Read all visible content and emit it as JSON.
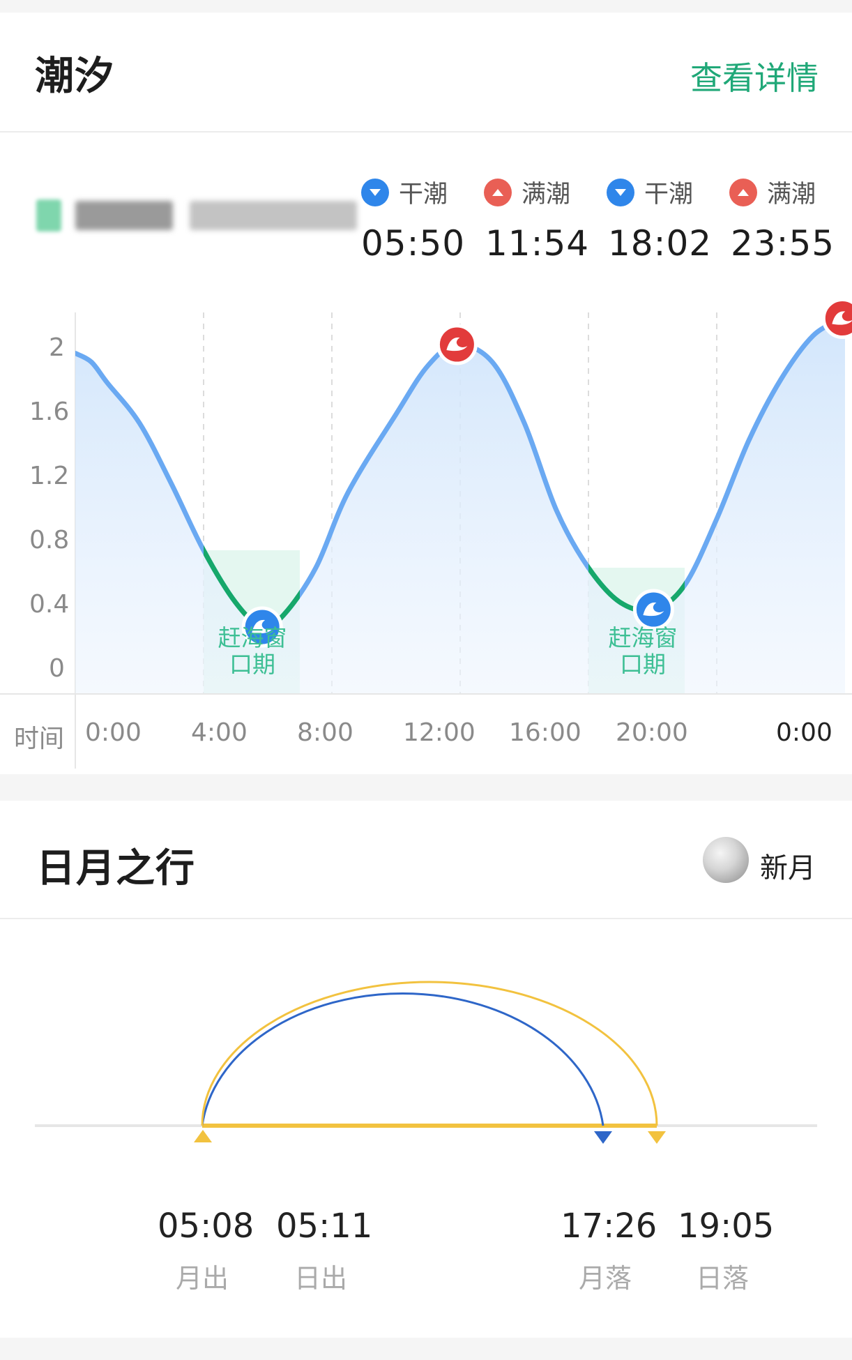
{
  "tide": {
    "title": "潮汐",
    "detail_link": "查看详情",
    "legend": [
      {
        "type": "low",
        "label": "干潮",
        "time": "05:50",
        "color": "#2f86ea"
      },
      {
        "type": "high",
        "label": "满潮",
        "time": "11:54",
        "color": "#e95f55"
      },
      {
        "type": "low",
        "label": "干潮",
        "time": "18:02",
        "color": "#2f86ea"
      },
      {
        "type": "high",
        "label": "满潮",
        "time": "23:55",
        "color": "#e95f55"
      }
    ],
    "window_label_line1": "赶海窗",
    "window_label_line2": "口期",
    "colors": {
      "curve": "#6aa9f2",
      "window_curve": "#16a86a",
      "fill": "#dbeafc",
      "window_text": "#3dbf94"
    }
  },
  "chart_data": {
    "type": "line",
    "x_unit": "hours",
    "xlim": [
      0,
      24
    ],
    "ylim": [
      0,
      2.1
    ],
    "yticks": [
      "2",
      "1.6",
      "1.2",
      "0.8",
      "0.4",
      "0"
    ],
    "ytick_values": [
      2,
      1.6,
      1.2,
      0.8,
      0.4,
      0
    ],
    "xlabel": "时间",
    "xticks": [
      "0:00",
      "4:00",
      "8:00",
      "12:00",
      "16:00",
      "20:00",
      "0:00"
    ],
    "xtick_values": [
      0,
      4,
      8,
      12,
      16,
      20,
      24
    ],
    "series": [
      {
        "x": [
          0,
          0.5,
          1,
          2,
          3,
          4,
          5,
          5.83,
          6.5,
          7.5,
          8.5,
          10,
          11,
          11.9,
          13,
          14,
          15,
          16,
          17,
          18.03,
          19,
          20,
          21,
          22,
          23,
          23.92,
          24
        ],
        "values": [
          1.95,
          1.9,
          1.78,
          1.55,
          1.2,
          0.82,
          0.52,
          0.38,
          0.45,
          0.72,
          1.15,
          1.6,
          1.88,
          2.0,
          1.9,
          1.55,
          1.05,
          0.72,
          0.52,
          0.48,
          0.62,
          1.0,
          1.45,
          1.8,
          2.05,
          2.15,
          2.18
        ]
      }
    ],
    "windows": [
      [
        4,
        7
      ],
      [
        16,
        19
      ]
    ],
    "markers": [
      {
        "x": 5.83,
        "type": "low"
      },
      {
        "x": 11.9,
        "type": "high"
      },
      {
        "x": 18.03,
        "type": "low"
      },
      {
        "x": 23.92,
        "type": "high"
      }
    ]
  },
  "sunmoon": {
    "title": "日月之行",
    "moon_phase": "新月",
    "items": [
      {
        "time": "05:08",
        "label": "月出"
      },
      {
        "time": "05:11",
        "label": "日出"
      },
      {
        "time": "17:26",
        "label": "月落"
      },
      {
        "time": "19:05",
        "label": "日落"
      }
    ],
    "colors": {
      "moon": "#2e66c8",
      "sun": "#f2c23f",
      "baseline": "#e6e6e6"
    }
  }
}
